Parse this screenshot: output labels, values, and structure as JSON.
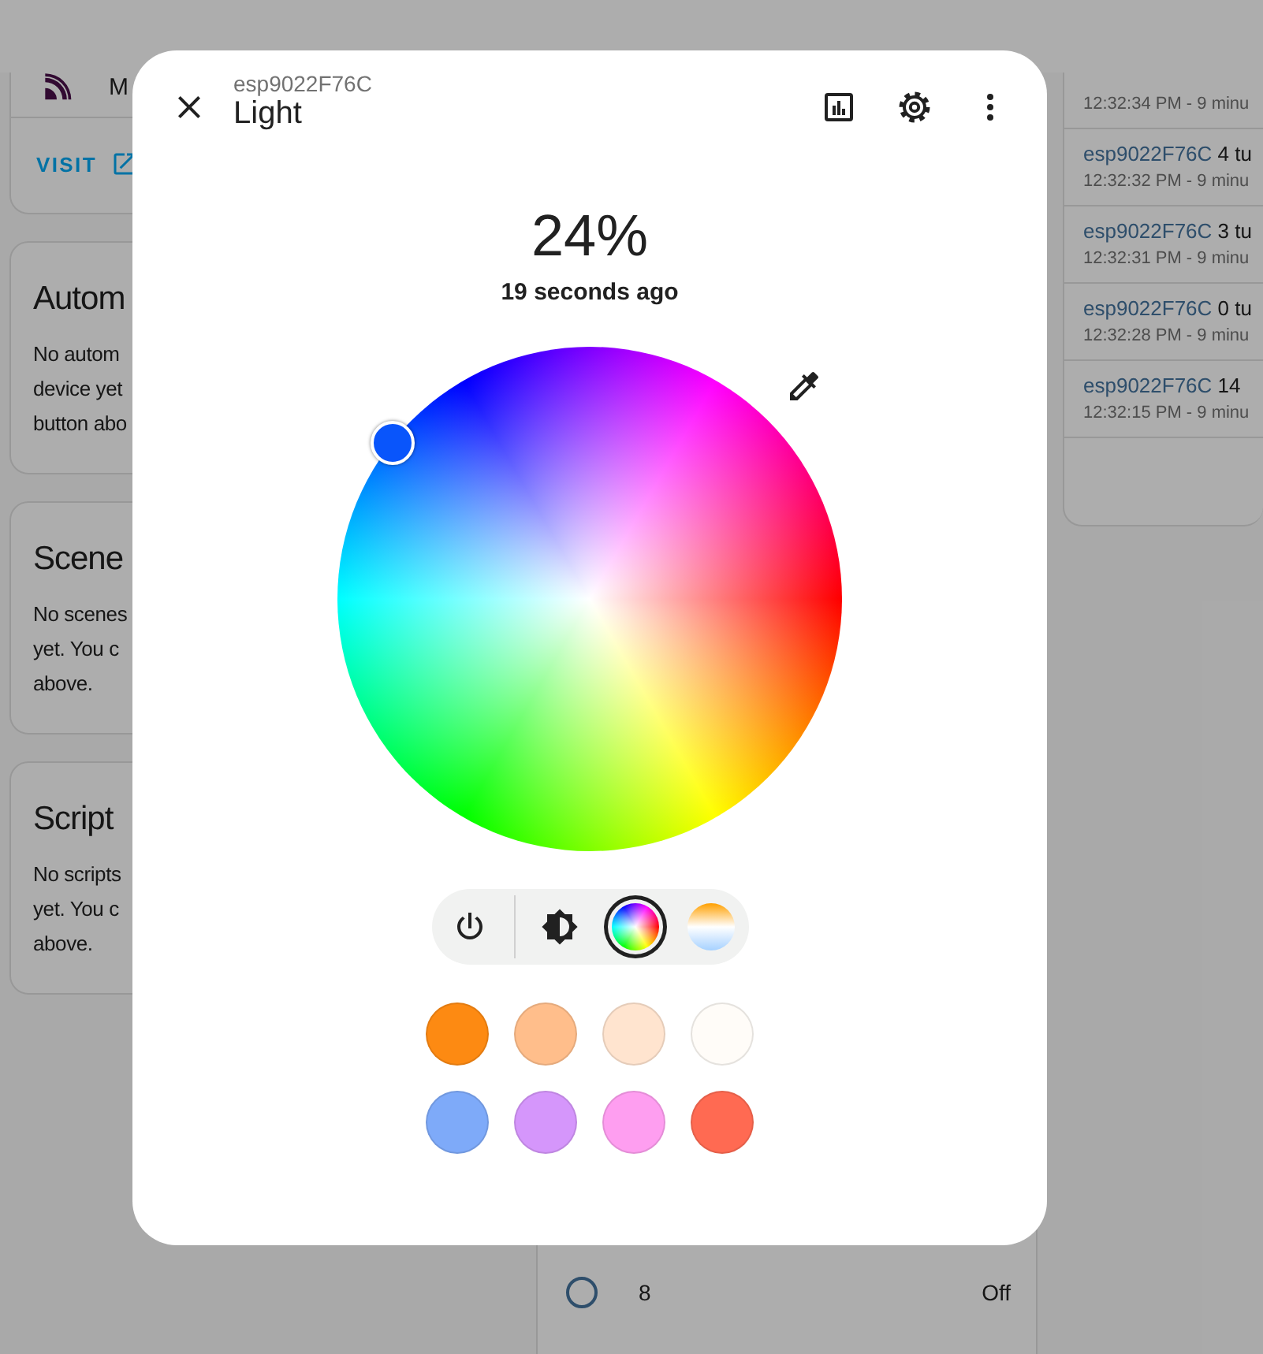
{
  "background": {
    "device_card": {
      "name": "M",
      "link": "VISIT"
    },
    "cards": [
      {
        "title": "Autom",
        "lines": [
          "No autom",
          "device yet",
          "button abo"
        ]
      },
      {
        "title": "Scene",
        "lines": [
          "No scenes",
          "yet. You c",
          "above."
        ]
      },
      {
        "title": "Script",
        "lines": [
          "No scripts",
          "yet. You c",
          "above."
        ]
      }
    ],
    "entities": [
      {
        "name": "8",
        "state": "Off",
        "on": false
      }
    ],
    "logbook": [
      {
        "time": "12:32:34 PM - 9 minu"
      },
      {
        "name": "esp9022F76C",
        "message": "4 tu",
        "time": "12:32:32 PM - 9 minu"
      },
      {
        "name": "esp9022F76C",
        "message": "3 tu",
        "time": "12:32:31 PM - 9 minu"
      },
      {
        "name": "esp9022F76C",
        "message": "0 tu",
        "time": "12:32:28 PM - 9 minu"
      },
      {
        "name": "esp9022F76C",
        "message": "14",
        "time": "12:32:15 PM - 9 minu"
      }
    ]
  },
  "dialog": {
    "subtitle": "esp9022F76C",
    "title": "Light",
    "brightness": "24%",
    "last_changed": "19 seconds ago",
    "modes": [
      {
        "kind": "brightness",
        "selected": false
      },
      {
        "kind": "color",
        "selected": true
      },
      {
        "kind": "temperature",
        "selected": false
      }
    ],
    "presets": [
      {
        "color": "#fd8a12"
      },
      {
        "color": "#ffbe8b"
      },
      {
        "color": "#ffe4cf"
      },
      {
        "color": "#fffcf8"
      },
      {
        "color": "#7eaaf9"
      },
      {
        "color": "#d596fb"
      },
      {
        "color": "#fe9ef0"
      },
      {
        "color": "#ff6a52"
      }
    ]
  }
}
